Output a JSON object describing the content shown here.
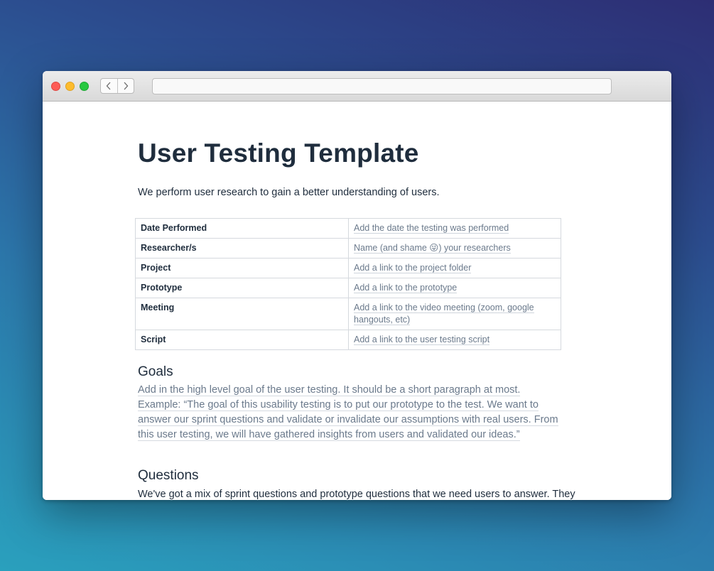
{
  "document": {
    "title": "User Testing Template",
    "intro": "We perform user research to gain a better understanding of users."
  },
  "table": {
    "rows": [
      {
        "label": "Date Performed",
        "value": "Add the date the testing was performed"
      },
      {
        "label": "Researcher/s",
        "value": "Name (and shame 😜) your researchers"
      },
      {
        "label": "Project",
        "value": "Add a link to the project folder"
      },
      {
        "label": "Prototype",
        "value": "Add a link to the prototype"
      },
      {
        "label": "Meeting",
        "value": "Add a link to the video meeting (zoom, google hangouts, etc)"
      },
      {
        "label": "Script",
        "value": "Add a link to the user testing script"
      }
    ]
  },
  "goals": {
    "heading": "Goals",
    "text": "Add in the high level goal of the user testing. It should be a short paragraph at most. Example: “The goal of this usability testing is to put our prototype to the test. We want to answer our sprint questions and validate or invalidate our assumptions with real users. From this user testing, we will have gathered insights from users and validated our ideas.”"
  },
  "questions": {
    "heading": "Questions",
    "text": "We've got a mix of sprint questions and prototype questions that we need users to answer. They"
  },
  "icons": {
    "back": "chevron-left-icon",
    "forward": "chevron-right-icon"
  },
  "colors": {
    "heading": "#1f2d3d",
    "placeholder": "#6b7a8c",
    "close": "#fd5c56",
    "minimize": "#fdbc2e",
    "maximize": "#27c840"
  }
}
